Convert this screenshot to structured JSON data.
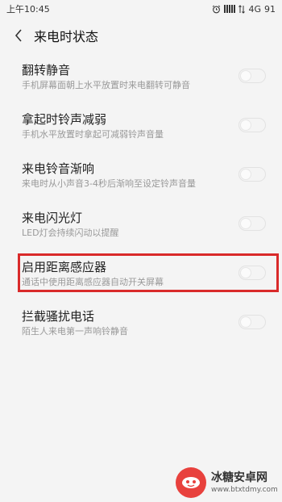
{
  "status_bar": {
    "time": "上午10:45",
    "network": "4G",
    "battery": "91"
  },
  "header": {
    "title": "来电时状态",
    "back_icon": "chevron-left-icon"
  },
  "settings": [
    {
      "title": "翻转静音",
      "description": "手机屏幕面朝上水平放置时来电翻转可静音",
      "enabled": false
    },
    {
      "title": "拿起时铃声减弱",
      "description": "手机水平放置时拿起可减弱铃声音量",
      "enabled": false
    },
    {
      "title": "来电铃音渐响",
      "description": "来电时从小声音3-4秒后渐响至设定铃声音量",
      "enabled": false
    },
    {
      "title": "来电闪光灯",
      "description": "LED灯会持续闪动以提醒",
      "enabled": false
    },
    {
      "title": "启用距离感应器",
      "description": "通话中使用距离感应器自动开关屏幕",
      "enabled": false
    },
    {
      "title": "拦截骚扰电话",
      "description": "陌生人来电第一声响铃静音",
      "enabled": false
    }
  ],
  "highlight": {
    "color": "#d92a2a",
    "target": "启用距离感应器"
  },
  "watermark": {
    "name": "冰糖安卓网",
    "url": "www.btxtdmy.com"
  }
}
